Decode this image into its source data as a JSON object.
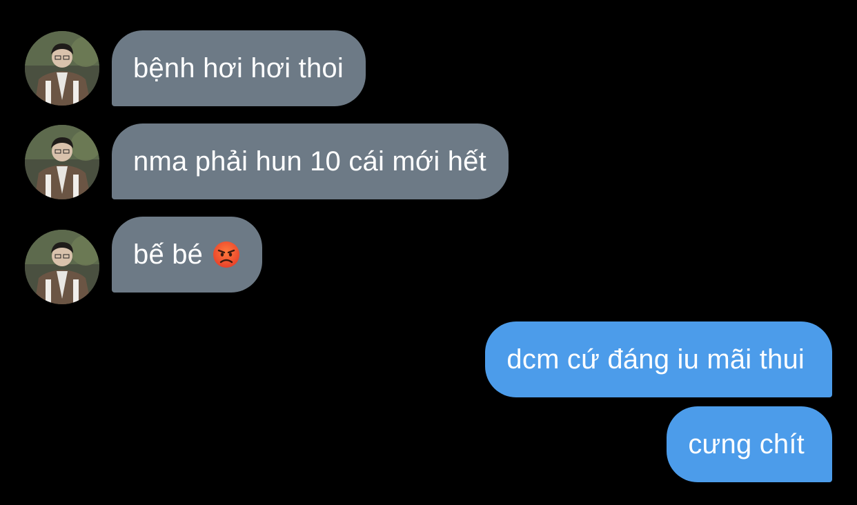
{
  "colors": {
    "background": "#000000",
    "incoming_bubble": "#6d7a86",
    "outgoing_bubble": "#4c9cea",
    "text": "#ffffff"
  },
  "messages": [
    {
      "direction": "incoming",
      "sender_avatar": "contact-avatar",
      "text": "bệnh hơi hơi thoi"
    },
    {
      "direction": "incoming",
      "sender_avatar": "contact-avatar",
      "text": "nma phải hun 10 cái mới hết"
    },
    {
      "direction": "incoming",
      "sender_avatar": "contact-avatar",
      "text": "bế bé",
      "emoji": "angry-face-icon"
    },
    {
      "direction": "outgoing",
      "text": "dcm cứ đáng iu mãi thui"
    },
    {
      "direction": "outgoing",
      "text": "cưng chít"
    }
  ]
}
